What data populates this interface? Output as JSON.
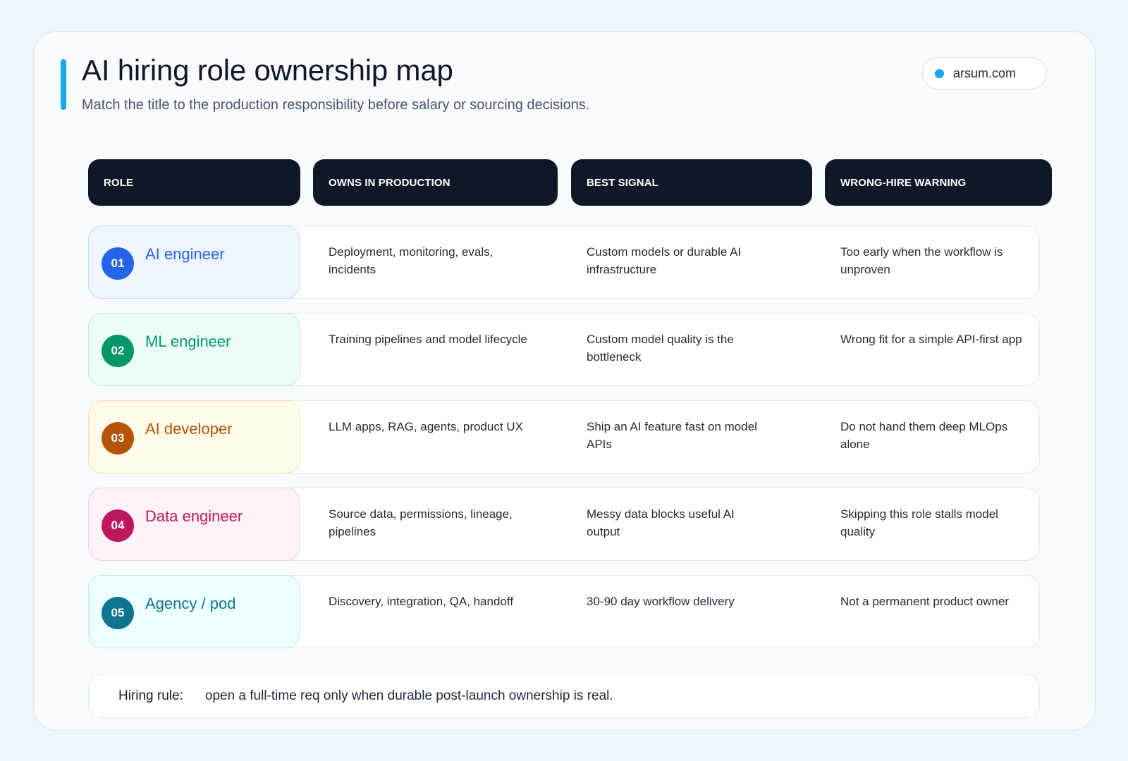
{
  "header": {
    "title": "AI hiring role ownership map",
    "subtitle": "Match the title to the production responsibility before salary or sourcing decisions.",
    "brand": "arsum.com"
  },
  "columns": [
    "ROLE",
    "OWNS IN PRODUCTION",
    "BEST SIGNAL",
    "WRONG-HIRE WARNING"
  ],
  "rows": [
    {
      "number": "01",
      "role": "AI engineer",
      "owns": "Deployment, monitoring, evals, incidents",
      "signal": "Custom models or durable AI infrastructure",
      "warning": "Too early when the workflow is unproven",
      "color": "#2563eb",
      "tint": "#eef5ff",
      "border": "#c7dcf5"
    },
    {
      "number": "02",
      "role": "ML engineer",
      "owns": "Training pipelines and model lifecycle",
      "signal": "Custom model quality is the bottleneck",
      "warning": "Wrong fit for a simple API-first app",
      "color": "#059669",
      "tint": "#ecfdf5",
      "border": "#bfeed8"
    },
    {
      "number": "03",
      "role": "AI developer",
      "owns": "LLM apps, RAG, agents, product UX",
      "signal": "Ship an AI feature fast on model APIs",
      "warning": "Do not hand them deep MLOps alone",
      "color": "#b45309",
      "tint": "#fffbeb",
      "border": "#f6e3a6"
    },
    {
      "number": "04",
      "role": "Data engineer",
      "owns": "Source data, permissions, lineage, pipelines",
      "signal": "Messy data blocks useful AI output",
      "warning": "Skipping this role stalls model quality",
      "color": "#be185d",
      "tint": "#fdf2f8",
      "border": "#f5cfe1"
    },
    {
      "number": "05",
      "role": "Agency / pod",
      "owns": "Discovery, integration, QA, handoff",
      "signal": "30-90 day workflow delivery",
      "warning": "Not a permanent product owner",
      "color": "#0e7490",
      "tint": "#ecfeff",
      "border": "#bcebf1"
    }
  ],
  "rule": {
    "label": "Hiring rule:",
    "text": "open a full-time req only when durable post-launch ownership is real."
  }
}
